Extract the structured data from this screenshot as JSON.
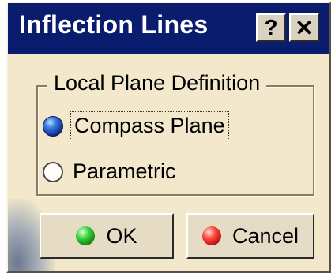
{
  "window": {
    "title": "Inflection Lines",
    "help_label": "?",
    "close_label": "✕"
  },
  "group": {
    "legend": "Local Plane Definition",
    "options": [
      {
        "label": "Compass Plane",
        "selected": true
      },
      {
        "label": "Parametric",
        "selected": false
      }
    ]
  },
  "buttons": {
    "ok_label": "OK",
    "cancel_label": "Cancel"
  },
  "colors": {
    "titlebar": "#0a1c6e",
    "dialog_bg": "#f4e8cc",
    "ok_led": "#3fd23f",
    "cancel_led": "#ff4a3a"
  },
  "icons": {
    "help": "help-icon",
    "close": "close-icon",
    "ok": "green-led-icon",
    "cancel": "red-led-icon"
  }
}
